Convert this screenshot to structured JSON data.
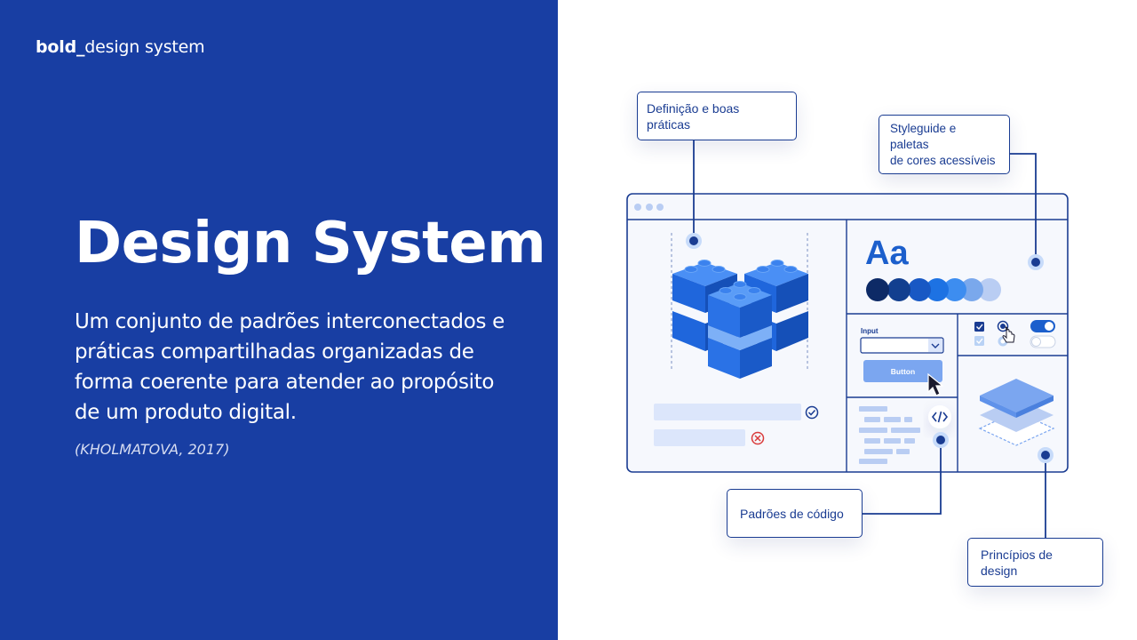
{
  "brand": {
    "bold": "bold_",
    "light": "design system"
  },
  "hero": {
    "title": "Design System",
    "description": "Um conjunto de padrões interconectados e práticas compartilhadas organizadas de forma coerente para atender ao propósito de um produto digital.",
    "citation": "(KHOLMATOVA, 2017)"
  },
  "illustration": {
    "callouts": {
      "definicao": "Definição e boas práticas",
      "styleguide": "Styleguide e paletas\nde cores acessíveis",
      "codigo": "Padrões de código",
      "principios": "Princípios de design"
    },
    "typography_sample": "Aa",
    "input_label": "Input",
    "button_label": "Button",
    "palette": [
      "#0d2a66",
      "#123f8f",
      "#1858c4",
      "#1d72e3",
      "#3d8df0",
      "#7aa8ec",
      "#b9cdf3"
    ],
    "colors": {
      "panel_blue": "#183ea3",
      "outline": "#1a3c92",
      "accent": "#1c5fcc",
      "light_block": "#dce6fb",
      "error": "#d93b3b"
    }
  }
}
